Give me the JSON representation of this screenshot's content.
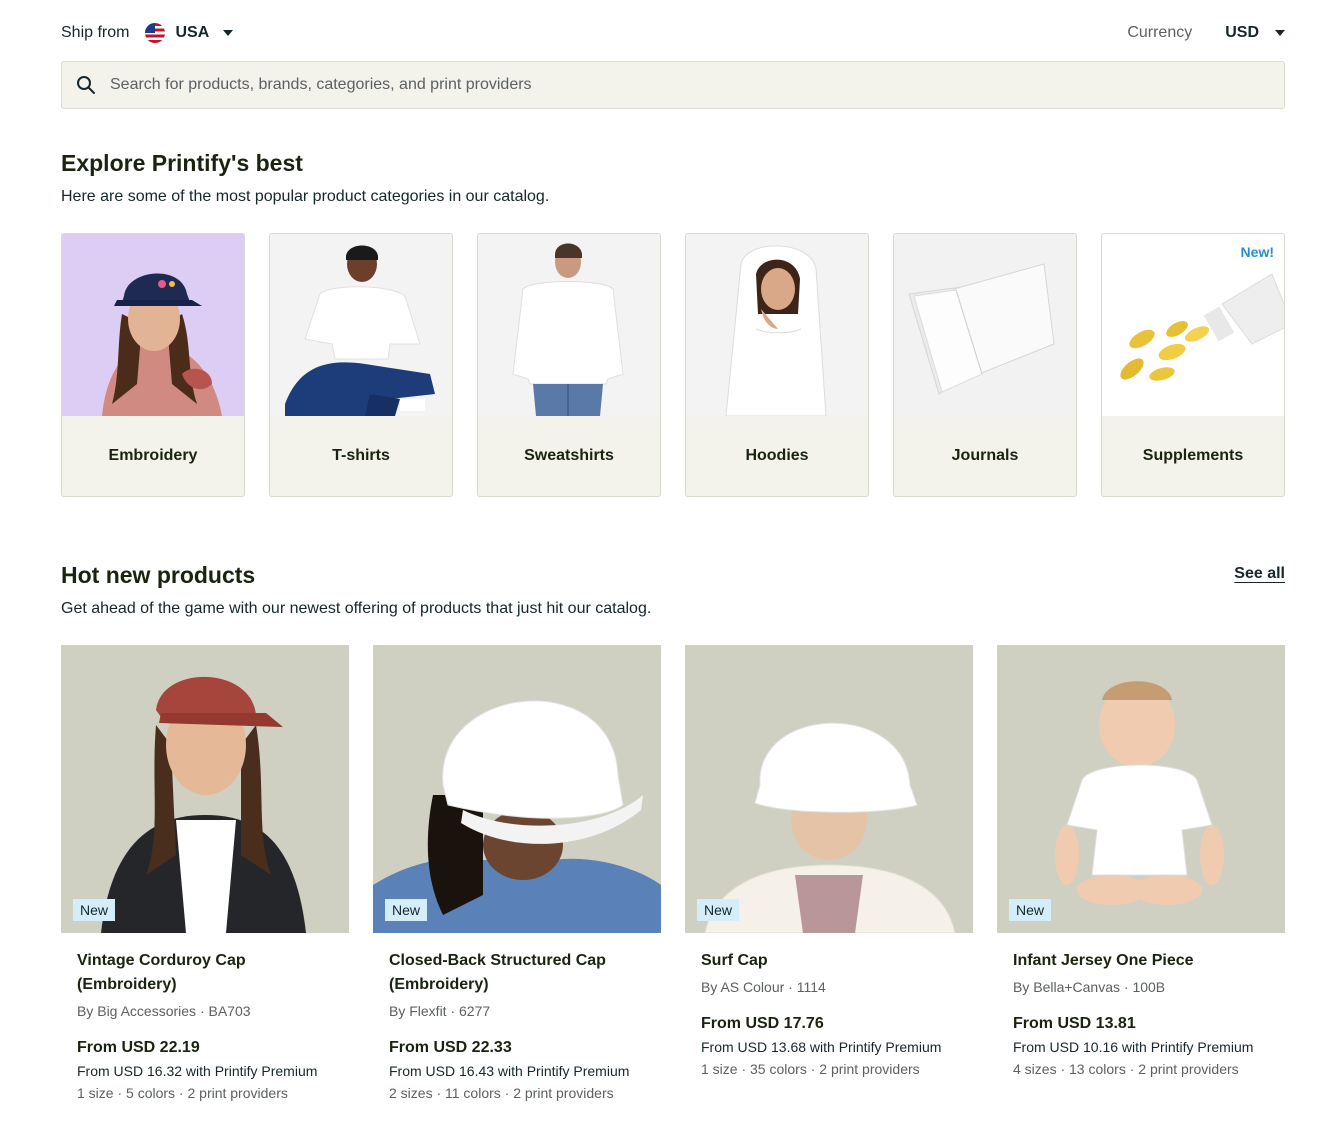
{
  "topbar": {
    "ship_from_label": "Ship from",
    "ship_from_value": "USA",
    "currency_label": "Currency",
    "currency_value": "USD"
  },
  "search": {
    "placeholder": "Search for products, brands, categories, and print providers"
  },
  "explore": {
    "title": "Explore Printify's best",
    "subtitle": "Here are some of the most popular product categories in our catalog.",
    "categories": [
      {
        "label": "Embroidery"
      },
      {
        "label": "T-shirts"
      },
      {
        "label": "Sweatshirts"
      },
      {
        "label": "Hoodies"
      },
      {
        "label": "Journals"
      },
      {
        "label": "Supplements",
        "tag": "New!"
      }
    ]
  },
  "hot": {
    "title": "Hot new products",
    "subtitle": "Get ahead of the game with our newest offering of products that just hit our catalog.",
    "see_all": "See all",
    "products": [
      {
        "badge": "New",
        "title": "Vintage Corduroy Cap (Embroidery)",
        "by": "By Big Accessories · BA703",
        "price": "From USD 22.19",
        "premium": "From USD 16.32 with Printify Premium",
        "meta": "1 size · 5 colors · 2 print providers"
      },
      {
        "badge": "New",
        "title": "Closed-Back Structured Cap (Embroidery)",
        "by": "By Flexfit · 6277",
        "price": "From USD 22.33",
        "premium": "From USD 16.43 with Printify Premium",
        "meta": "2 sizes · 11 colors · 2 print providers"
      },
      {
        "badge": "New",
        "title": "Surf Cap",
        "by": "By AS Colour · 1114",
        "price": "From USD 17.76",
        "premium": "From USD 13.68 with Printify Premium",
        "meta": "1 size · 35 colors · 2 print providers"
      },
      {
        "badge": "New",
        "title": "Infant Jersey One Piece",
        "by": "By Bella+Canvas · 100B",
        "price": "From USD 13.81",
        "premium": "From USD 10.16 with Printify Premium",
        "meta": "4 sizes · 13 colors · 2 print providers"
      }
    ]
  },
  "colors": {
    "search_bg": "#f3f3ec",
    "badge_bg": "#d3eefa",
    "new_tag": "#2a8fc7",
    "card_bg": "#f3f3ec"
  }
}
